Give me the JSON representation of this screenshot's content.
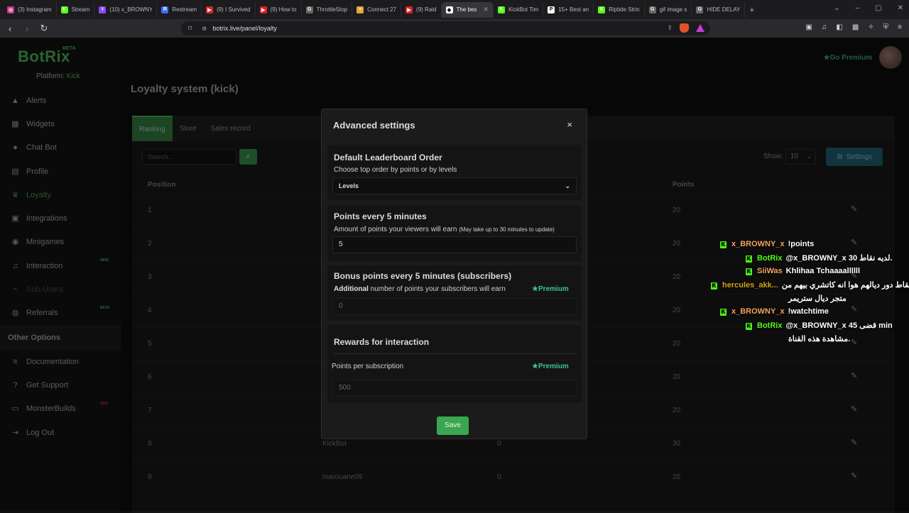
{
  "browser": {
    "tabs": [
      {
        "label": "(3) Instagram",
        "color": "#c13584",
        "glyph": "◎"
      },
      {
        "label": "Stream",
        "color": "#53fc18",
        "glyph": "K"
      },
      {
        "label": "(10) x_BROWNY",
        "color": "#9146ff",
        "glyph": "t"
      },
      {
        "label": "Restream",
        "color": "#3a6cf4",
        "glyph": "R"
      },
      {
        "label": "(9) I Survived",
        "color": "#e02020",
        "glyph": "▶"
      },
      {
        "label": "(9) How to",
        "color": "#e02020",
        "glyph": "▶"
      },
      {
        "label": "ThrottleStop",
        "color": "#666666",
        "glyph": "G"
      },
      {
        "label": "Connect 27",
        "color": "#e8a33d",
        "glyph": "≡"
      },
      {
        "label": "(9) Raid",
        "color": "#e02020",
        "glyph": "▶"
      },
      {
        "label": "The bes",
        "color": "#ffffff",
        "glyph": "◆",
        "active": true
      },
      {
        "label": "KickBot Tim",
        "color": "#53fc18",
        "glyph": "K"
      },
      {
        "label": "15+ Best an",
        "color": "#ffffff",
        "glyph": "P"
      },
      {
        "label": "Riptide Strin",
        "color": "#53fc18",
        "glyph": "K"
      },
      {
        "label": "gif image s",
        "color": "#666666",
        "glyph": "G"
      },
      {
        "label": "HIDE DELAY",
        "color": "#666666",
        "glyph": "G"
      }
    ],
    "url": "botrix.live/panel/loyalty"
  },
  "sidebar": {
    "logo": "BotRix",
    "beta": "BETA",
    "platform_label": "Platform:",
    "platform_value": "Kick",
    "items": [
      {
        "label": "Alerts",
        "icon": "▲",
        "name": "alerts"
      },
      {
        "label": "Widgets",
        "icon": "▦",
        "name": "widgets"
      },
      {
        "label": "Chat Bot",
        "icon": "●",
        "name": "chat-bot"
      },
      {
        "label": "Profile",
        "icon": "▤",
        "name": "profile"
      },
      {
        "label": "Loyalty",
        "icon": "♛",
        "name": "loyalty",
        "active": true
      },
      {
        "label": "Integrations",
        "icon": "▣",
        "name": "integrations"
      },
      {
        "label": "Minigames",
        "icon": "◉",
        "name": "minigames"
      },
      {
        "label": "Interaction",
        "icon": "♫",
        "name": "interaction",
        "tag": "NEW"
      },
      {
        "label": "Sub-Users",
        "icon": "◓",
        "name": "sub-users",
        "disabled": true
      },
      {
        "label": "Referrals",
        "icon": "◍",
        "name": "referrals",
        "tag": "BETA"
      }
    ],
    "other_title": "Other Options",
    "other_items": [
      {
        "label": "Documentation",
        "icon": "≡",
        "name": "documentation"
      },
      {
        "label": "Get Support",
        "icon": "?",
        "name": "get-support"
      },
      {
        "label": "MonsterBuilds",
        "icon": "▭",
        "name": "monsterbuilds",
        "tag": "ADS"
      },
      {
        "label": "Log Out",
        "icon": "⇥",
        "name": "log-out"
      }
    ]
  },
  "header": {
    "go_premium": "Go Premium"
  },
  "page": {
    "title": "Loyalty system (kick)",
    "tabs": [
      "Ranking",
      "Store",
      "Sales record"
    ],
    "search_placeholder": "Search...",
    "show_label": "Show:",
    "show_value": "10",
    "settings_label": "Settings",
    "columns": {
      "position": "Position",
      "points": "Points"
    },
    "rows": [
      {
        "position": "1",
        "user": "",
        "level": "",
        "points": "20"
      },
      {
        "position": "2",
        "user": "",
        "level": "",
        "points": "20"
      },
      {
        "position": "3",
        "user": "",
        "level": "",
        "points": "20"
      },
      {
        "position": "4",
        "user": "",
        "level": "",
        "points": "20"
      },
      {
        "position": "5",
        "user": "",
        "level": "",
        "points": "20"
      },
      {
        "position": "6",
        "user": "",
        "level": "",
        "points": "20"
      },
      {
        "position": "7",
        "user": "",
        "level": "",
        "points": "20"
      },
      {
        "position": "8",
        "user": "KickBot",
        "level": "0",
        "points": "30"
      },
      {
        "position": "9",
        "user": "marouane09",
        "level": "0",
        "points": "20"
      }
    ]
  },
  "modal": {
    "title": "Advanced settings",
    "close": "×",
    "leaderboard": {
      "title": "Default Leaderboard Order",
      "desc": "Choose top order by points or by levels",
      "value": "Levels"
    },
    "points": {
      "title": "Points every 5 minutes",
      "desc": "Amount of points your viewers will earn",
      "note": "(May take up to 30 minutes to update)",
      "value": "5"
    },
    "bonus": {
      "title": "Bonus points every 5 minutes (subscribers)",
      "desc_bold": "Additional",
      "desc": "number of points your subscribers will earn",
      "premium": "Premium",
      "value": "0"
    },
    "rewards": {
      "title": "Rewards for interaction",
      "label": "Points per subscription",
      "premium": "Premium",
      "value": "500"
    },
    "save": "Save"
  },
  "chat": [
    {
      "user": "x_BROWNY_x",
      "color": "#f4a460",
      "text": "!points"
    },
    {
      "user": "BotRix",
      "color": "#53fc18",
      "text": "@x_BROWNY_x لديه نقاط 30."
    },
    {
      "user": "SiiWas",
      "color": "#f4a460",
      "text": "Khlihaa Tchaaaallllll"
    },
    {
      "user": "hercules_akk...",
      "color": "#d4a017",
      "text": "نقاط دور ديالهم هوا انه كاتشري بيهم من"
    },
    {
      "user": "",
      "color": "#ffffff",
      "text": "متجر ديال ستريمر"
    },
    {
      "user": "x_BROWNY_x",
      "color": "#f4a460",
      "text": "!watchtime"
    },
    {
      "user": "BotRix",
      "color": "#53fc18",
      "text": "@x_BROWNY_x قضى 45 min"
    },
    {
      "user": "",
      "color": "#ffffff",
      "text": "مشاهدة هذه القناة."
    }
  ]
}
